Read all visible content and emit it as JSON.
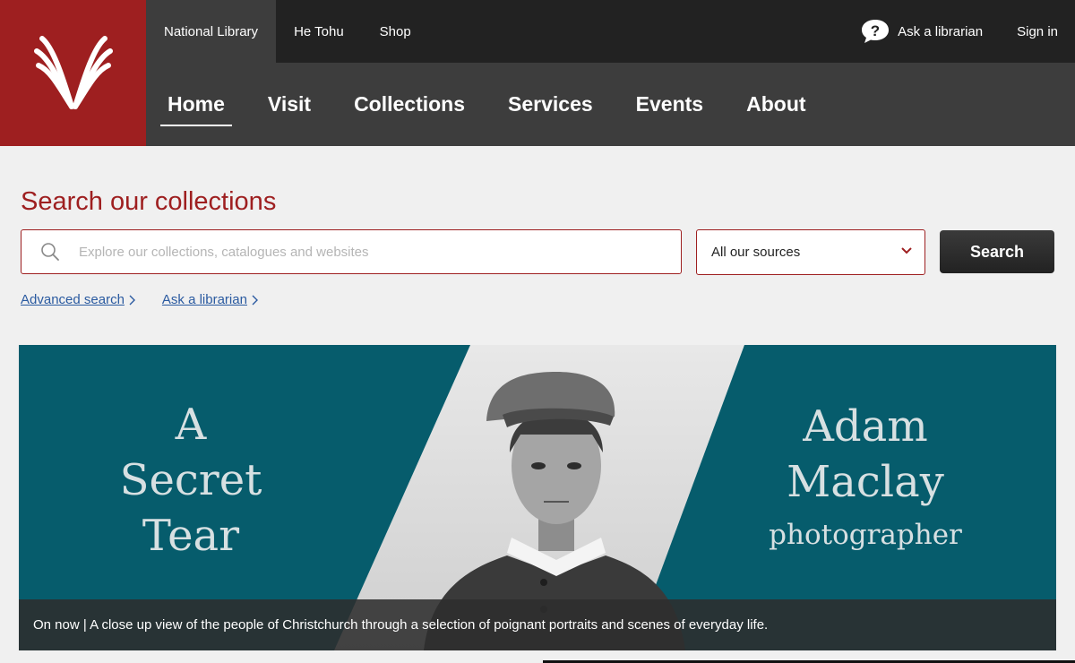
{
  "header": {
    "logo_icon": "national-library-logo",
    "utility_links": [
      "National Library",
      "He Tohu",
      "Shop"
    ],
    "ask_librarian": "Ask a librarian",
    "sign_in": "Sign in",
    "nav": [
      "Home",
      "Visit",
      "Collections",
      "Services",
      "Events",
      "About"
    ],
    "active_nav": "Home"
  },
  "search": {
    "title": "Search our collections",
    "placeholder": "Explore our collections, catalogues and websites",
    "source_selected": "All our sources",
    "button_label": "Search",
    "links": [
      "Advanced search",
      "Ask a librarian"
    ]
  },
  "banner": {
    "left_title": [
      "A",
      "Secret",
      "Tear"
    ],
    "right_name": [
      "Adam",
      "Maclay"
    ],
    "right_role": "photographer",
    "caption": "On now | A close up view of the people of Christchurch through a selection of poignant portraits and scenes of everyday life."
  },
  "colors": {
    "brand_red": "#9e1f20",
    "banner_teal": "#065c6c",
    "dark": "#222222",
    "nav_gray": "#3d3d3d"
  }
}
